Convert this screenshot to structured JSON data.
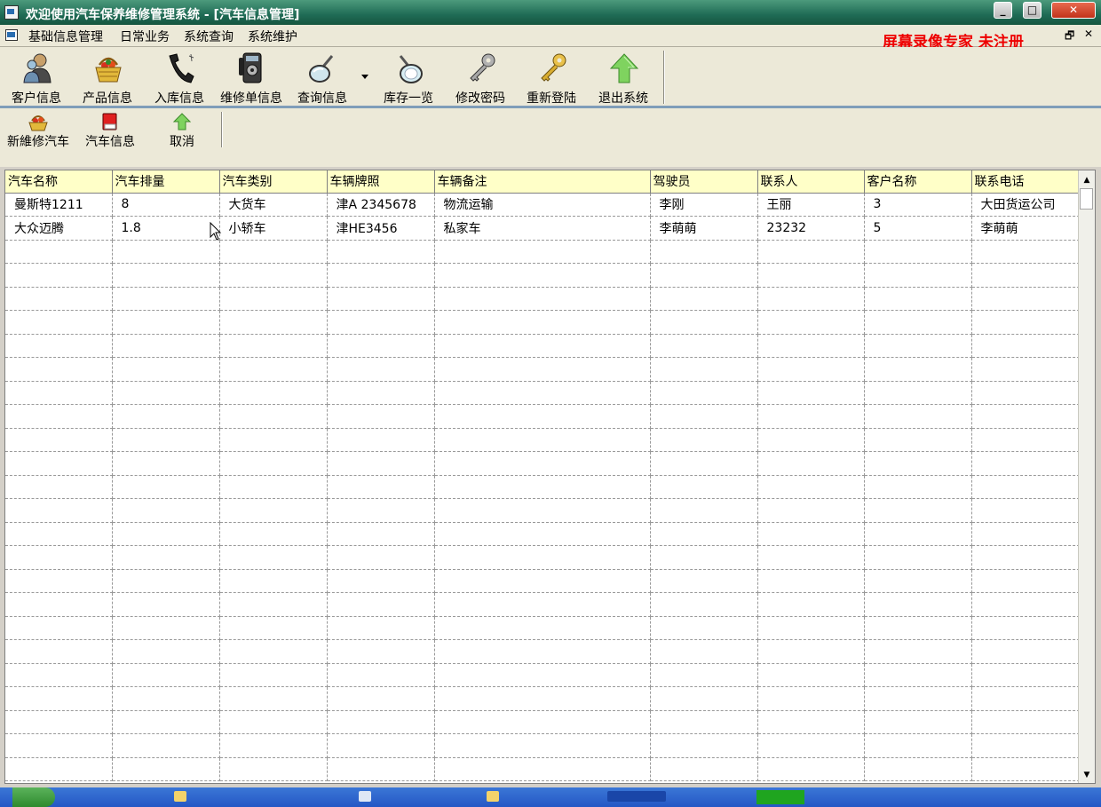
{
  "window": {
    "title": "欢迎使用汽车保养维修管理系统 - [汽车信息管理]",
    "minimize_glyph": "_",
    "maximize_glyph": "□",
    "close_glyph": "✕"
  },
  "menubar": {
    "items": [
      "基础信息管理",
      "日常业务",
      "系统查询",
      "系统维护"
    ],
    "watermark": "屏幕录像专家  未注册",
    "mdi_restore_glyph": "🗗",
    "mdi_close_glyph": "✕"
  },
  "toolbar": {
    "buttons": [
      {
        "label": "客户信息",
        "icon": "users-icon"
      },
      {
        "label": "产品信息",
        "icon": "basket-icon"
      },
      {
        "label": "入库信息",
        "icon": "telephone-icon"
      },
      {
        "label": "维修单信息",
        "icon": "payphone-icon"
      },
      {
        "label": "查询信息",
        "icon": "magnifier-icon"
      },
      {
        "label": "库存一览",
        "icon": "magnifier-lens-icon"
      },
      {
        "label": "修改密码",
        "icon": "grey-key-icon"
      },
      {
        "label": "重新登陆",
        "icon": "gold-key-icon"
      },
      {
        "label": "退出系统",
        "icon": "green-up-arrow-icon"
      }
    ]
  },
  "subtoolbar": {
    "buttons": [
      {
        "label": "新維修汽车",
        "icon": "basket-small-icon"
      },
      {
        "label": "汽车信息",
        "icon": "red-book-icon"
      },
      {
        "label": "取消",
        "icon": "green-up-arrow-small-icon"
      }
    ]
  },
  "grid": {
    "columns": [
      "汽车名称",
      "汽车排量",
      "汽车类别",
      "车辆牌照",
      "车辆备注",
      "驾驶员",
      "联系人",
      "客户名称",
      "联系电话"
    ],
    "rows": [
      [
        "曼斯特1211",
        "8",
        "大货车",
        "津A 2345678",
        "物流运输",
        "李刚",
        "王丽",
        "3",
        "大田货运公司"
      ],
      [
        "大众迈腾",
        "1.8",
        "小轿车",
        "津HE3456",
        "私家车",
        "李萌萌",
        "23232",
        "5",
        "李萌萌"
      ]
    ],
    "empty_rows": 23
  },
  "colors": {
    "titlebar": "#1f6b55",
    "header_bg": "#ffffc8",
    "watermark": "#ee0000",
    "taskbar": "#2457c5"
  }
}
